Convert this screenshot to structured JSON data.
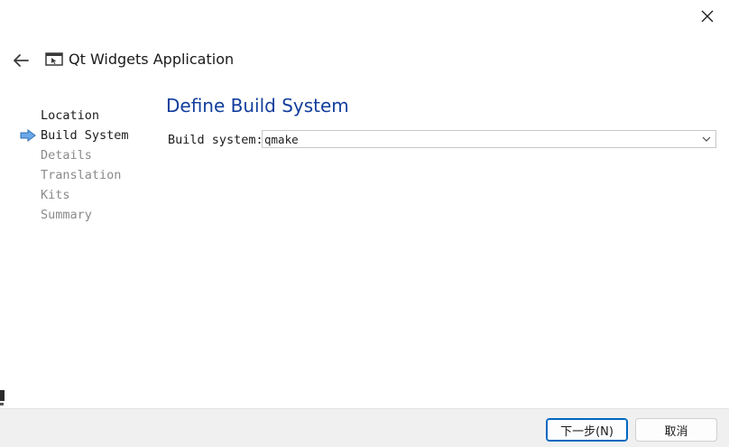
{
  "window": {
    "title": "Qt Widgets Application",
    "close_icon": "close-icon",
    "back_icon": "arrow-left-icon",
    "app_icon": "app-window-icon"
  },
  "steps": [
    {
      "label": "Location",
      "state": "done"
    },
    {
      "label": "Build System",
      "state": "current"
    },
    {
      "label": "Details",
      "state": "future"
    },
    {
      "label": "Translation",
      "state": "future"
    },
    {
      "label": "Kits",
      "state": "future"
    },
    {
      "label": "Summary",
      "state": "future"
    }
  ],
  "page": {
    "title": "Define Build System",
    "build_system_label": "Build system:",
    "build_system_value": "qmake"
  },
  "footer": {
    "next_label": "下一步(N)",
    "cancel_label": "取消"
  },
  "colors": {
    "title_blue": "#123e9c",
    "step_arrow": "#4a90d9",
    "primary_border": "#0067c0",
    "footer_bg": "#f0f0f0"
  }
}
